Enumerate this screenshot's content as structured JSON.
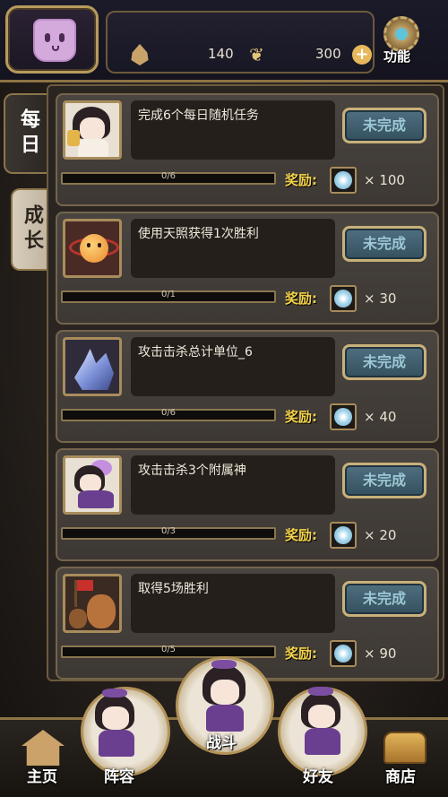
{
  "header": {
    "resource_a": "140",
    "resource_b": "300",
    "function_label": "功能",
    "plus_symbol": "+"
  },
  "side_tabs": {
    "daily": "每日",
    "growth": "成长"
  },
  "tasks": [
    {
      "desc": "完成6个每日随机任务",
      "status": "未完成",
      "progress": "0/6",
      "progress_value": 0,
      "reward_label": "奖励:",
      "reward_qty": "× 100",
      "icon": "cat-girl-icon"
    },
    {
      "desc": "使用天照获得1次胜利",
      "status": "未完成",
      "progress": "0/1",
      "progress_value": 0,
      "reward_label": "奖励:",
      "reward_qty": "× 30",
      "icon": "sun-spirit-icon"
    },
    {
      "desc": "攻击击杀总计单位_6",
      "status": "未完成",
      "progress": "0/6",
      "progress_value": 0,
      "reward_label": "奖励:",
      "reward_qty": "× 40",
      "icon": "crystal-icon"
    },
    {
      "desc": "攻击击杀3个附属神",
      "status": "未完成",
      "progress": "0/3",
      "progress_value": 0,
      "reward_label": "奖励:",
      "reward_qty": "× 20",
      "icon": "fairy-girl-icon"
    },
    {
      "desc": "取得5场胜利",
      "status": "未完成",
      "progress": "0/5",
      "progress_value": 0,
      "reward_label": "奖励:",
      "reward_qty": "× 90",
      "icon": "bear-flag-icon"
    }
  ],
  "nav": {
    "home": "主页",
    "lineup": "阵容",
    "battle": "战斗",
    "friends": "好友",
    "shop": "商店"
  },
  "colors": {
    "reward_label": "#f3d24b",
    "status_button": "#4f6f80",
    "frame_gold": "#b89a5c"
  }
}
